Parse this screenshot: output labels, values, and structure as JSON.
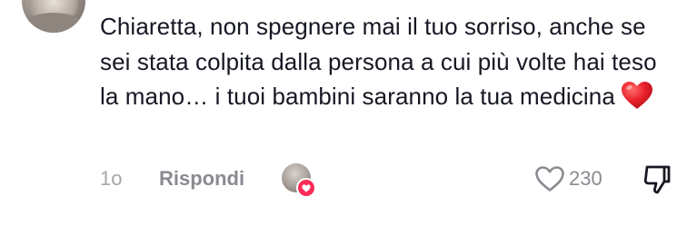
{
  "comment": {
    "text": "Chiaretta, non spegnere mai il tuo sorriso, anche se sei stata colpita dalla persona a cui più volte hai teso la mano… i tuoi bambini saranno la tua medicina",
    "emoji_icon": "red-heart-emoji",
    "time": "1o",
    "reply_label": "Rispondi",
    "like_count": "230",
    "liked_by_creator": true,
    "colors": {
      "text": "#161823",
      "muted": "#8a8b91",
      "heart_emoji": "#e8202a",
      "creator_like_badge": "#fe2c55"
    }
  }
}
